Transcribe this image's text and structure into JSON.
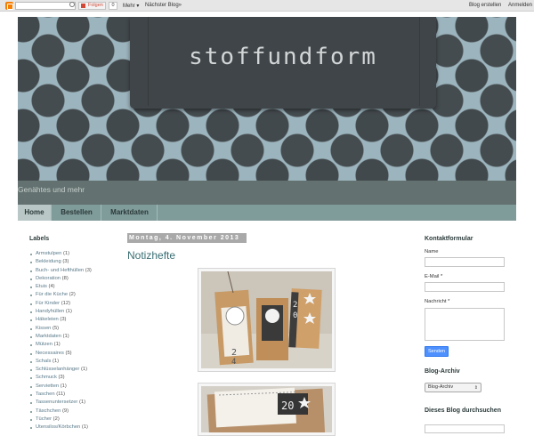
{
  "navbar": {
    "follow_label": "Folgen",
    "follow_count": "0",
    "more_label": "Mehr",
    "next_blog_label": "Nächster Blog»",
    "create_blog_label": "Blog erstellen",
    "login_label": "Anmelden"
  },
  "header": {
    "title": "stoffundform",
    "description": "Genähtes und mehr"
  },
  "tabs": [
    {
      "label": "Home",
      "active": true
    },
    {
      "label": "Bestellen",
      "active": false
    },
    {
      "label": "Marktdaten",
      "active": false
    }
  ],
  "labels_widget": {
    "title": "Labels",
    "items": [
      {
        "name": "Armstulpen",
        "count": "(1)"
      },
      {
        "name": "Bekleidung",
        "count": "(3)"
      },
      {
        "name": "Buch- und Hefthüllen",
        "count": "(3)"
      },
      {
        "name": "Dekoration",
        "count": "(8)"
      },
      {
        "name": "Etuis",
        "count": "(4)"
      },
      {
        "name": "Für die Küche",
        "count": "(2)"
      },
      {
        "name": "Für Kinder",
        "count": "(12)"
      },
      {
        "name": "Handyhüllen",
        "count": "(1)"
      },
      {
        "name": "Häkeleien",
        "count": "(3)"
      },
      {
        "name": "Kissen",
        "count": "(5)"
      },
      {
        "name": "Marktdaten",
        "count": "(1)"
      },
      {
        "name": "Mützen",
        "count": "(1)"
      },
      {
        "name": "Necessaires",
        "count": "(5)"
      },
      {
        "name": "Schals",
        "count": "(1)"
      },
      {
        "name": "Schlüsselanhänger",
        "count": "(1)"
      },
      {
        "name": "Schmuck",
        "count": "(3)"
      },
      {
        "name": "Servietten",
        "count": "(1)"
      },
      {
        "name": "Taschen",
        "count": "(11)"
      },
      {
        "name": "Tassenuntersetzer",
        "count": "(1)"
      },
      {
        "name": "Täschchen",
        "count": "(9)"
      },
      {
        "name": "Tücher",
        "count": "(2)"
      },
      {
        "name": "Utensilos/Körbchen",
        "count": "(1)"
      }
    ]
  },
  "post": {
    "date": "Montag, 4. November 2013",
    "title": "Notizhefte"
  },
  "contact_form": {
    "title": "Kontaktformular",
    "name_label": "Name",
    "email_label": "E-Mail *",
    "message_label": "Nachricht *",
    "send_label": "Senden"
  },
  "archive": {
    "title": "Blog-Archiv",
    "selected": "Blog-Archiv"
  },
  "search_widget": {
    "title": "Dieses Blog durchsuchen"
  }
}
